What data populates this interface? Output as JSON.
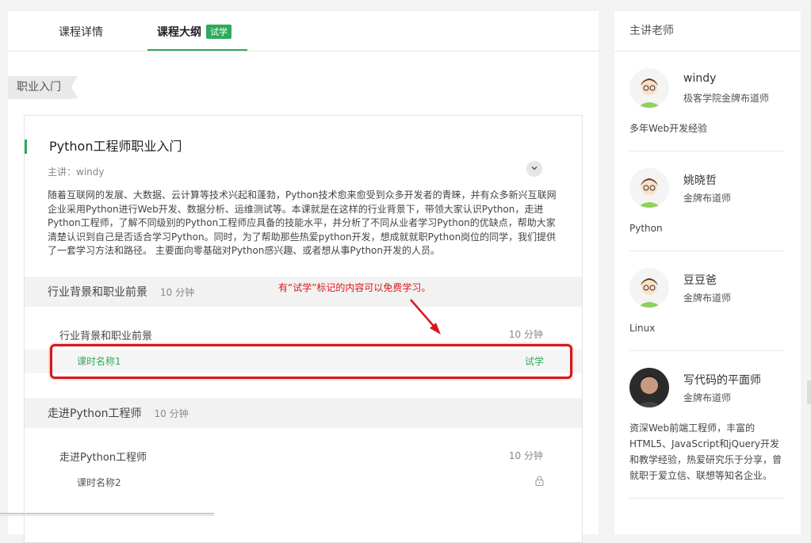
{
  "tabs": [
    {
      "label": "课程详情"
    },
    {
      "label": "课程大纲",
      "badge": "试学"
    }
  ],
  "section_tag": "职业入门",
  "course": {
    "title": "Python工程师职业入门",
    "lecturer": "主讲：windy",
    "description": "随着互联网的发展、大数据、云计算等技术兴起和蓬勃，Python技术愈来愈受到众多开发者的青睐，并有众多新兴互联网企业采用Python进行Web开发、数据分析、运维测试等。本课就是在这样的行业背景下，带领大家认识Python，走进Python工程师，了解不同级别的Python工程师应具备的技能水平，并分析了不同从业者学习Python的优缺点，帮助大家清楚认识到自己是否适合学习Python。同时，为了帮助那些热爱python开发，想成就就职Python岗位的同学，我们提供了一套学习方法和路径。 主要面向零基础对Python感兴趣、或者想从事Python开发的人员。",
    "toggle_icon": "chevron-down-icon"
  },
  "chapters": [
    {
      "title": "行业背景和职业前景",
      "duration": "10 分钟",
      "section": {
        "title": "行业背景和职业前景",
        "duration": "10 分钟"
      },
      "lesson": {
        "title": "课时名称1",
        "status": "试学"
      }
    },
    {
      "title": "走进Python工程师",
      "duration": "10 分钟",
      "section": {
        "title": "走进Python工程师",
        "duration": "10 分钟"
      },
      "lesson": {
        "title": "课时名称2",
        "status_icon": "lock-icon"
      }
    }
  ],
  "annotation": {
    "text": "有“试学”标记的内容可以免费学习。",
    "color": "#e0161a"
  },
  "teachers_panel": {
    "title": "主讲老师",
    "teachers": [
      {
        "name": "windy",
        "title": "极客学院金牌布道师",
        "desc": "多年Web开发经验"
      },
      {
        "name": "姚晓哲",
        "title": "金牌布道师",
        "desc": "Python"
      },
      {
        "name": "豆豆爸",
        "title": "金牌布道师",
        "desc": "Linux"
      },
      {
        "name": "写代码的平面师",
        "title": "金牌布道师",
        "desc": "资深Web前端工程师，丰富的HTML5、JavaScript和jQuery开发和教学经验，热爱研究乐于分享，曾就职于爱立信、联想等知名企业。"
      }
    ]
  },
  "colors": {
    "accent": "#2eaa5a",
    "annotation_red": "#d6171a"
  }
}
